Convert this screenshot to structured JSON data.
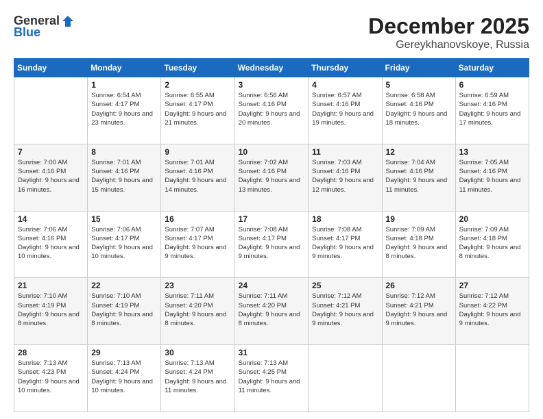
{
  "logo": {
    "general": "General",
    "blue": "Blue"
  },
  "header": {
    "month": "December 2025",
    "location": "Gereykhanovskoye, Russia"
  },
  "weekdays": [
    "Sunday",
    "Monday",
    "Tuesday",
    "Wednesday",
    "Thursday",
    "Friday",
    "Saturday"
  ],
  "weeks": [
    [
      {
        "day": "",
        "sunrise": "",
        "sunset": "",
        "daylight": ""
      },
      {
        "day": "1",
        "sunrise": "Sunrise: 6:54 AM",
        "sunset": "Sunset: 4:17 PM",
        "daylight": "Daylight: 9 hours and 23 minutes."
      },
      {
        "day": "2",
        "sunrise": "Sunrise: 6:55 AM",
        "sunset": "Sunset: 4:17 PM",
        "daylight": "Daylight: 9 hours and 21 minutes."
      },
      {
        "day": "3",
        "sunrise": "Sunrise: 6:56 AM",
        "sunset": "Sunset: 4:16 PM",
        "daylight": "Daylight: 9 hours and 20 minutes."
      },
      {
        "day": "4",
        "sunrise": "Sunrise: 6:57 AM",
        "sunset": "Sunset: 4:16 PM",
        "daylight": "Daylight: 9 hours and 19 minutes."
      },
      {
        "day": "5",
        "sunrise": "Sunrise: 6:58 AM",
        "sunset": "Sunset: 4:16 PM",
        "daylight": "Daylight: 9 hours and 18 minutes."
      },
      {
        "day": "6",
        "sunrise": "Sunrise: 6:59 AM",
        "sunset": "Sunset: 4:16 PM",
        "daylight": "Daylight: 9 hours and 17 minutes."
      }
    ],
    [
      {
        "day": "7",
        "sunrise": "Sunrise: 7:00 AM",
        "sunset": "Sunset: 4:16 PM",
        "daylight": "Daylight: 9 hours and 16 minutes."
      },
      {
        "day": "8",
        "sunrise": "Sunrise: 7:01 AM",
        "sunset": "Sunset: 4:16 PM",
        "daylight": "Daylight: 9 hours and 15 minutes."
      },
      {
        "day": "9",
        "sunrise": "Sunrise: 7:01 AM",
        "sunset": "Sunset: 4:16 PM",
        "daylight": "Daylight: 9 hours and 14 minutes."
      },
      {
        "day": "10",
        "sunrise": "Sunrise: 7:02 AM",
        "sunset": "Sunset: 4:16 PM",
        "daylight": "Daylight: 9 hours and 13 minutes."
      },
      {
        "day": "11",
        "sunrise": "Sunrise: 7:03 AM",
        "sunset": "Sunset: 4:16 PM",
        "daylight": "Daylight: 9 hours and 12 minutes."
      },
      {
        "day": "12",
        "sunrise": "Sunrise: 7:04 AM",
        "sunset": "Sunset: 4:16 PM",
        "daylight": "Daylight: 9 hours and 11 minutes."
      },
      {
        "day": "13",
        "sunrise": "Sunrise: 7:05 AM",
        "sunset": "Sunset: 4:16 PM",
        "daylight": "Daylight: 9 hours and 11 minutes."
      }
    ],
    [
      {
        "day": "14",
        "sunrise": "Sunrise: 7:06 AM",
        "sunset": "Sunset: 4:16 PM",
        "daylight": "Daylight: 9 hours and 10 minutes."
      },
      {
        "day": "15",
        "sunrise": "Sunrise: 7:06 AM",
        "sunset": "Sunset: 4:17 PM",
        "daylight": "Daylight: 9 hours and 10 minutes."
      },
      {
        "day": "16",
        "sunrise": "Sunrise: 7:07 AM",
        "sunset": "Sunset: 4:17 PM",
        "daylight": "Daylight: 9 hours and 9 minutes."
      },
      {
        "day": "17",
        "sunrise": "Sunrise: 7:08 AM",
        "sunset": "Sunset: 4:17 PM",
        "daylight": "Daylight: 9 hours and 9 minutes."
      },
      {
        "day": "18",
        "sunrise": "Sunrise: 7:08 AM",
        "sunset": "Sunset: 4:17 PM",
        "daylight": "Daylight: 9 hours and 9 minutes."
      },
      {
        "day": "19",
        "sunrise": "Sunrise: 7:09 AM",
        "sunset": "Sunset: 4:18 PM",
        "daylight": "Daylight: 9 hours and 8 minutes."
      },
      {
        "day": "20",
        "sunrise": "Sunrise: 7:09 AM",
        "sunset": "Sunset: 4:18 PM",
        "daylight": "Daylight: 9 hours and 8 minutes."
      }
    ],
    [
      {
        "day": "21",
        "sunrise": "Sunrise: 7:10 AM",
        "sunset": "Sunset: 4:19 PM",
        "daylight": "Daylight: 9 hours and 8 minutes."
      },
      {
        "day": "22",
        "sunrise": "Sunrise: 7:10 AM",
        "sunset": "Sunset: 4:19 PM",
        "daylight": "Daylight: 9 hours and 8 minutes."
      },
      {
        "day": "23",
        "sunrise": "Sunrise: 7:11 AM",
        "sunset": "Sunset: 4:20 PM",
        "daylight": "Daylight: 9 hours and 8 minutes."
      },
      {
        "day": "24",
        "sunrise": "Sunrise: 7:11 AM",
        "sunset": "Sunset: 4:20 PM",
        "daylight": "Daylight: 9 hours and 8 minutes."
      },
      {
        "day": "25",
        "sunrise": "Sunrise: 7:12 AM",
        "sunset": "Sunset: 4:21 PM",
        "daylight": "Daylight: 9 hours and 9 minutes."
      },
      {
        "day": "26",
        "sunrise": "Sunrise: 7:12 AM",
        "sunset": "Sunset: 4:21 PM",
        "daylight": "Daylight: 9 hours and 9 minutes."
      },
      {
        "day": "27",
        "sunrise": "Sunrise: 7:12 AM",
        "sunset": "Sunset: 4:22 PM",
        "daylight": "Daylight: 9 hours and 9 minutes."
      }
    ],
    [
      {
        "day": "28",
        "sunrise": "Sunrise: 7:13 AM",
        "sunset": "Sunset: 4:23 PM",
        "daylight": "Daylight: 9 hours and 10 minutes."
      },
      {
        "day": "29",
        "sunrise": "Sunrise: 7:13 AM",
        "sunset": "Sunset: 4:24 PM",
        "daylight": "Daylight: 9 hours and 10 minutes."
      },
      {
        "day": "30",
        "sunrise": "Sunrise: 7:13 AM",
        "sunset": "Sunset: 4:24 PM",
        "daylight": "Daylight: 9 hours and 11 minutes."
      },
      {
        "day": "31",
        "sunrise": "Sunrise: 7:13 AM",
        "sunset": "Sunset: 4:25 PM",
        "daylight": "Daylight: 9 hours and 11 minutes."
      },
      {
        "day": "",
        "sunrise": "",
        "sunset": "",
        "daylight": ""
      },
      {
        "day": "",
        "sunrise": "",
        "sunset": "",
        "daylight": ""
      },
      {
        "day": "",
        "sunrise": "",
        "sunset": "",
        "daylight": ""
      }
    ]
  ]
}
